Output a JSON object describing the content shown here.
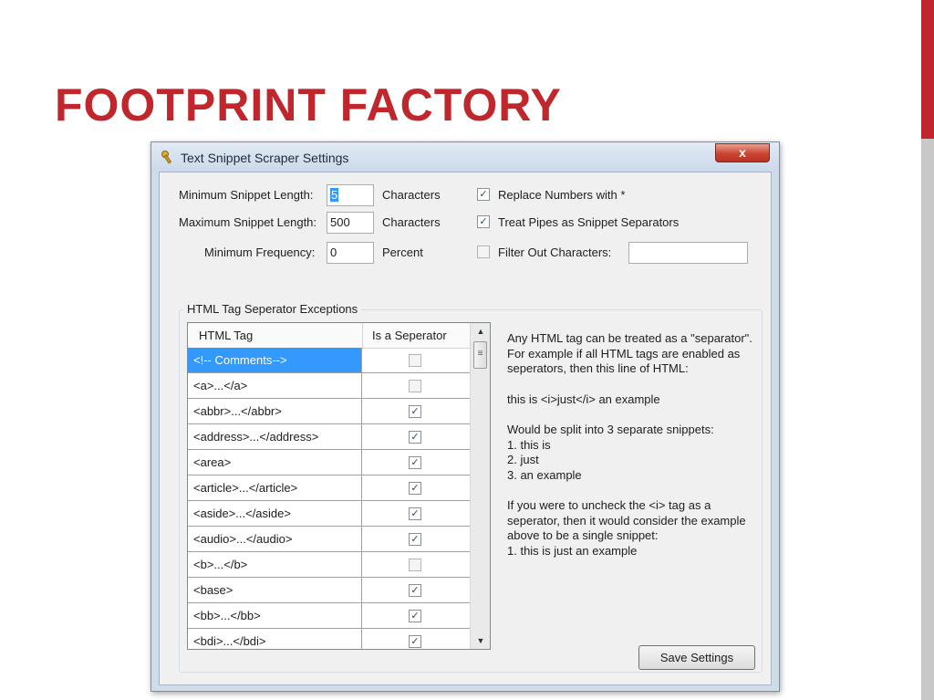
{
  "slide": {
    "title": "FOOTPRINT FACTORY"
  },
  "window": {
    "title": "Text Snippet Scraper Settings",
    "close_label": "x"
  },
  "settings": {
    "min_length": {
      "label": "Minimum Snippet Length:",
      "value": "5",
      "unit": "Characters"
    },
    "max_length": {
      "label": "Maximum Snippet Length:",
      "value": "500",
      "unit": "Characters"
    },
    "min_frequency": {
      "label": "Minimum Frequency:",
      "value": "0",
      "unit": "Percent"
    },
    "replace_numbers": {
      "label": "Replace Numbers with *",
      "checked": true
    },
    "treat_pipes": {
      "label": "Treat Pipes as Snippet Separators",
      "checked": true
    },
    "filter_chars": {
      "label": "Filter Out Characters:",
      "checked": false,
      "value": ""
    }
  },
  "group": {
    "title": "HTML Tag Seperator Exceptions"
  },
  "grid": {
    "columns": [
      "HTML Tag",
      "Is a Seperator"
    ],
    "rows": [
      {
        "tag": "<!-- Comments-->",
        "is_separator": false,
        "selected": true
      },
      {
        "tag": "<a>...</a>",
        "is_separator": false
      },
      {
        "tag": "<abbr>...</abbr>",
        "is_separator": true
      },
      {
        "tag": "<address>...</address>",
        "is_separator": true
      },
      {
        "tag": "<area>",
        "is_separator": true
      },
      {
        "tag": "<article>...</article>",
        "is_separator": true
      },
      {
        "tag": "<aside>...</aside>",
        "is_separator": true
      },
      {
        "tag": "<audio>...</audio>",
        "is_separator": true
      },
      {
        "tag": "<b>...</b>",
        "is_separator": false
      },
      {
        "tag": "<base>",
        "is_separator": true
      },
      {
        "tag": "<bb>...</bb>",
        "is_separator": true
      },
      {
        "tag": "<bdi>...</bdi>",
        "is_separator": true
      }
    ]
  },
  "help": {
    "p1": "Any HTML tag can be treated as a \"separator\".  For example if all HTML tags are enabled as seperators, then this line of HTML:",
    "p2": "this is <i>just</i> an example",
    "p3_intro": "Would be split into 3 separate snippets:",
    "p3_items": [
      "1. this is",
      "2. just",
      "3. an example"
    ],
    "p4": "If you were to uncheck the <i> tag as a seperator, then it would consider the example above to be a single snippet:",
    "p4_item": "1. this is just an example"
  },
  "buttons": {
    "save": "Save Settings"
  },
  "colors": {
    "title_red": "#c0272d",
    "selection_blue": "#3399ff"
  }
}
